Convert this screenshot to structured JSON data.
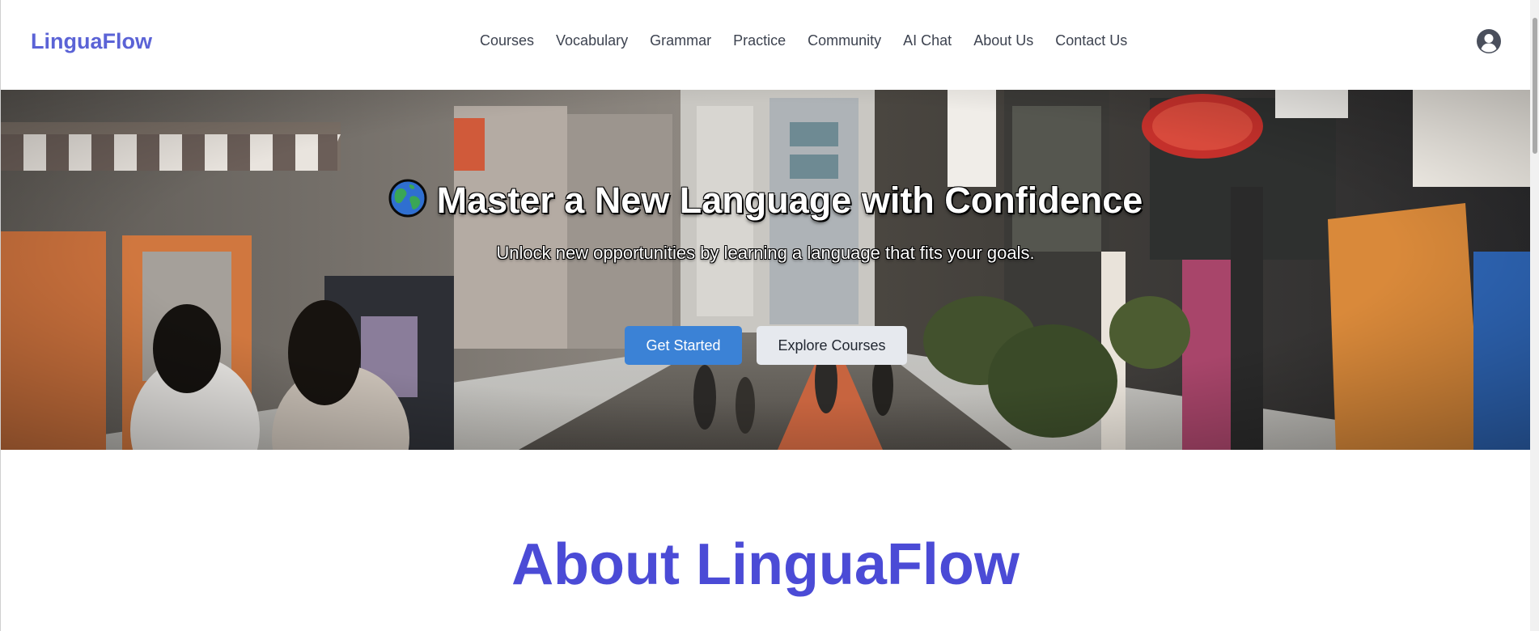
{
  "header": {
    "brand": "LinguaFlow",
    "nav": [
      "Courses",
      "Vocabulary",
      "Grammar",
      "Practice",
      "Community",
      "AI Chat",
      "About Us",
      "Contact Us"
    ],
    "user_icon": "user-circle-icon"
  },
  "hero": {
    "title_icon": "globe-icon",
    "title": "Master a New Language with Confidence",
    "subtitle": "Unlock new opportunities by learning a language that fits your goals.",
    "primary_button": "Get Started",
    "secondary_button": "Explore Courses",
    "background_image": "street-scene"
  },
  "about": {
    "title": "About LinguaFlow"
  },
  "colors": {
    "brand": "#5b63d6",
    "primary_button": "#3b82d6",
    "secondary_button": "#e6e9ee",
    "about_title": "#4b4bd6"
  }
}
